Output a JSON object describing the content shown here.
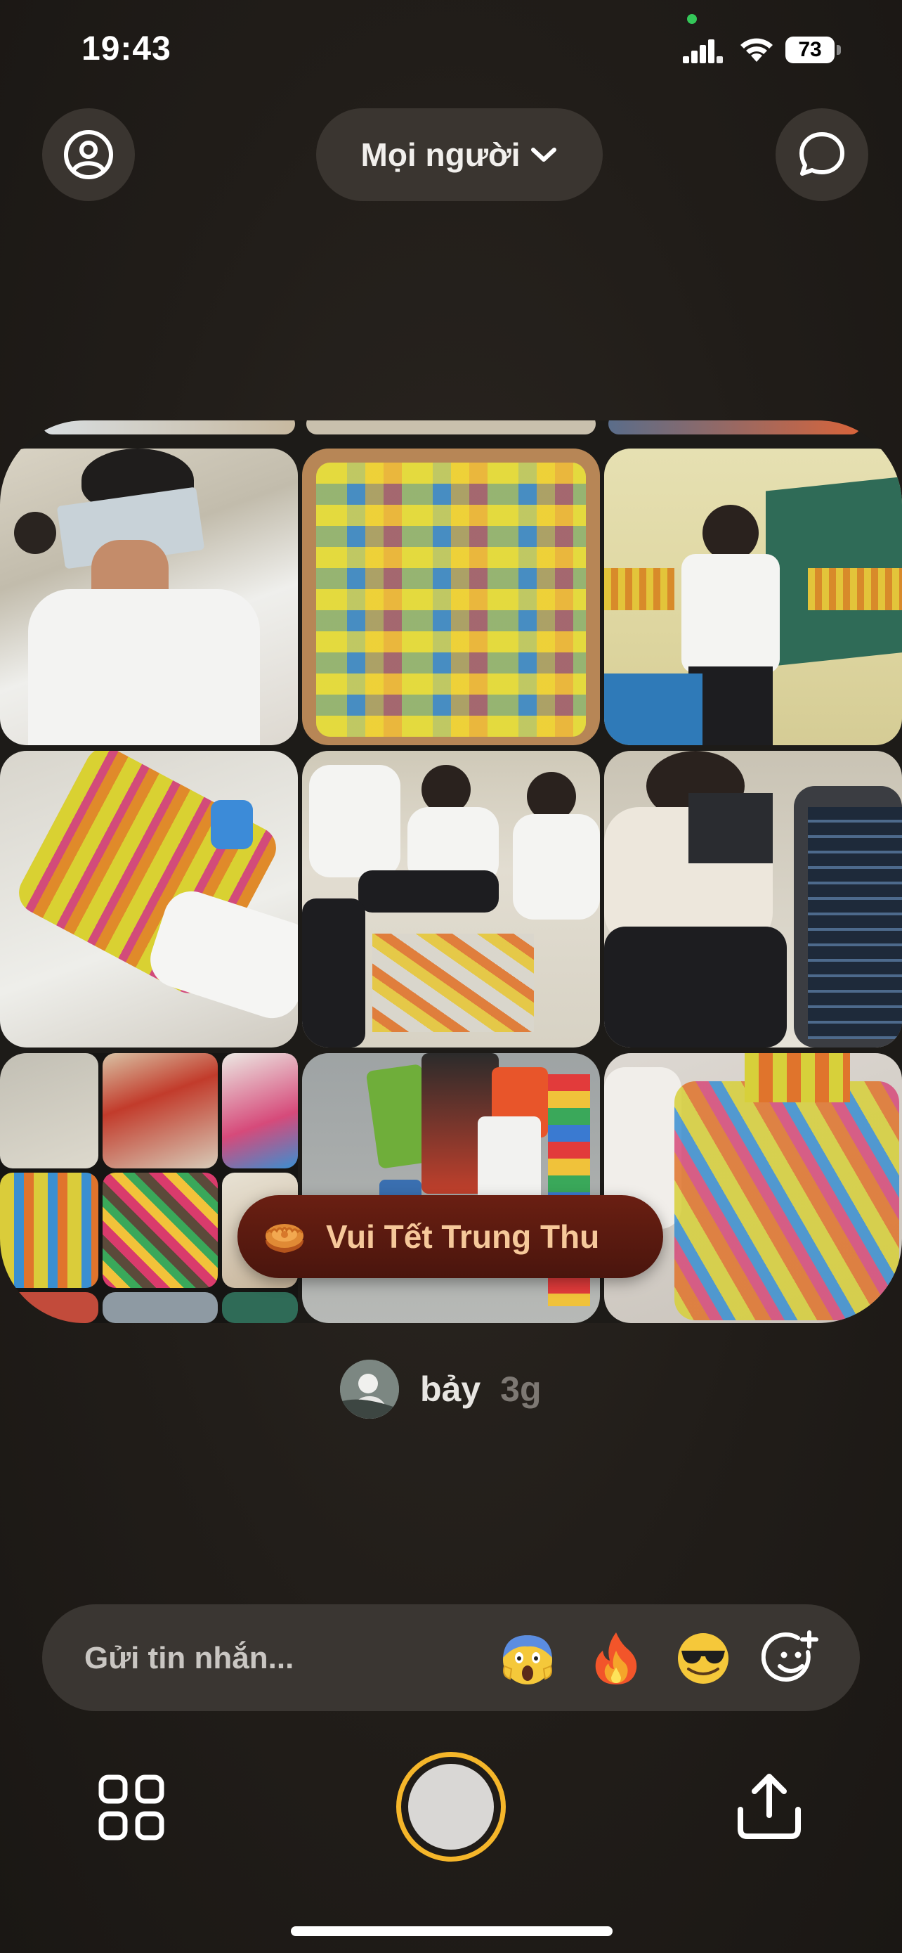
{
  "status_bar": {
    "time": "19:43",
    "battery": "73"
  },
  "header": {
    "audience_label": "Mọi người"
  },
  "post": {
    "caption": "Vui Tết Trung Thu",
    "author": "bảy",
    "age": "3g"
  },
  "composer": {
    "placeholder": "Gửi tin nhắn...",
    "reactions": [
      "😱",
      "🔥",
      "😎"
    ]
  },
  "icons": {
    "profile": "person-circle-icon",
    "chat": "chat-bubble-icon",
    "dropdown": "chevron-down-icon",
    "caption": "mooncake-icon",
    "add_reaction": "smiley-plus-icon",
    "grid": "grid-icon",
    "share": "share-upload-icon"
  },
  "colors": {
    "shutter_ring": "#f5b62a",
    "caption_badge": "#5a1a10",
    "caption_text": "#f6c89a",
    "status_dot": "#34c759"
  }
}
